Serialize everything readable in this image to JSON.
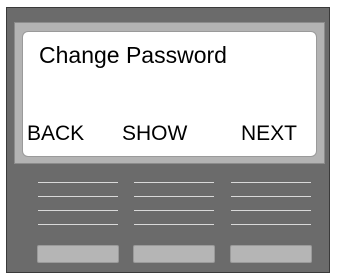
{
  "screen": {
    "title": "Change Password"
  },
  "softkeys": {
    "back": "BACK",
    "show": "SHOW",
    "next": "NEXT"
  },
  "colors": {
    "device_body": "#6b6b6b",
    "bezel": "#b3b3b3",
    "screen_bg": "#ffffff",
    "button_gray": "#b5b5b5"
  }
}
